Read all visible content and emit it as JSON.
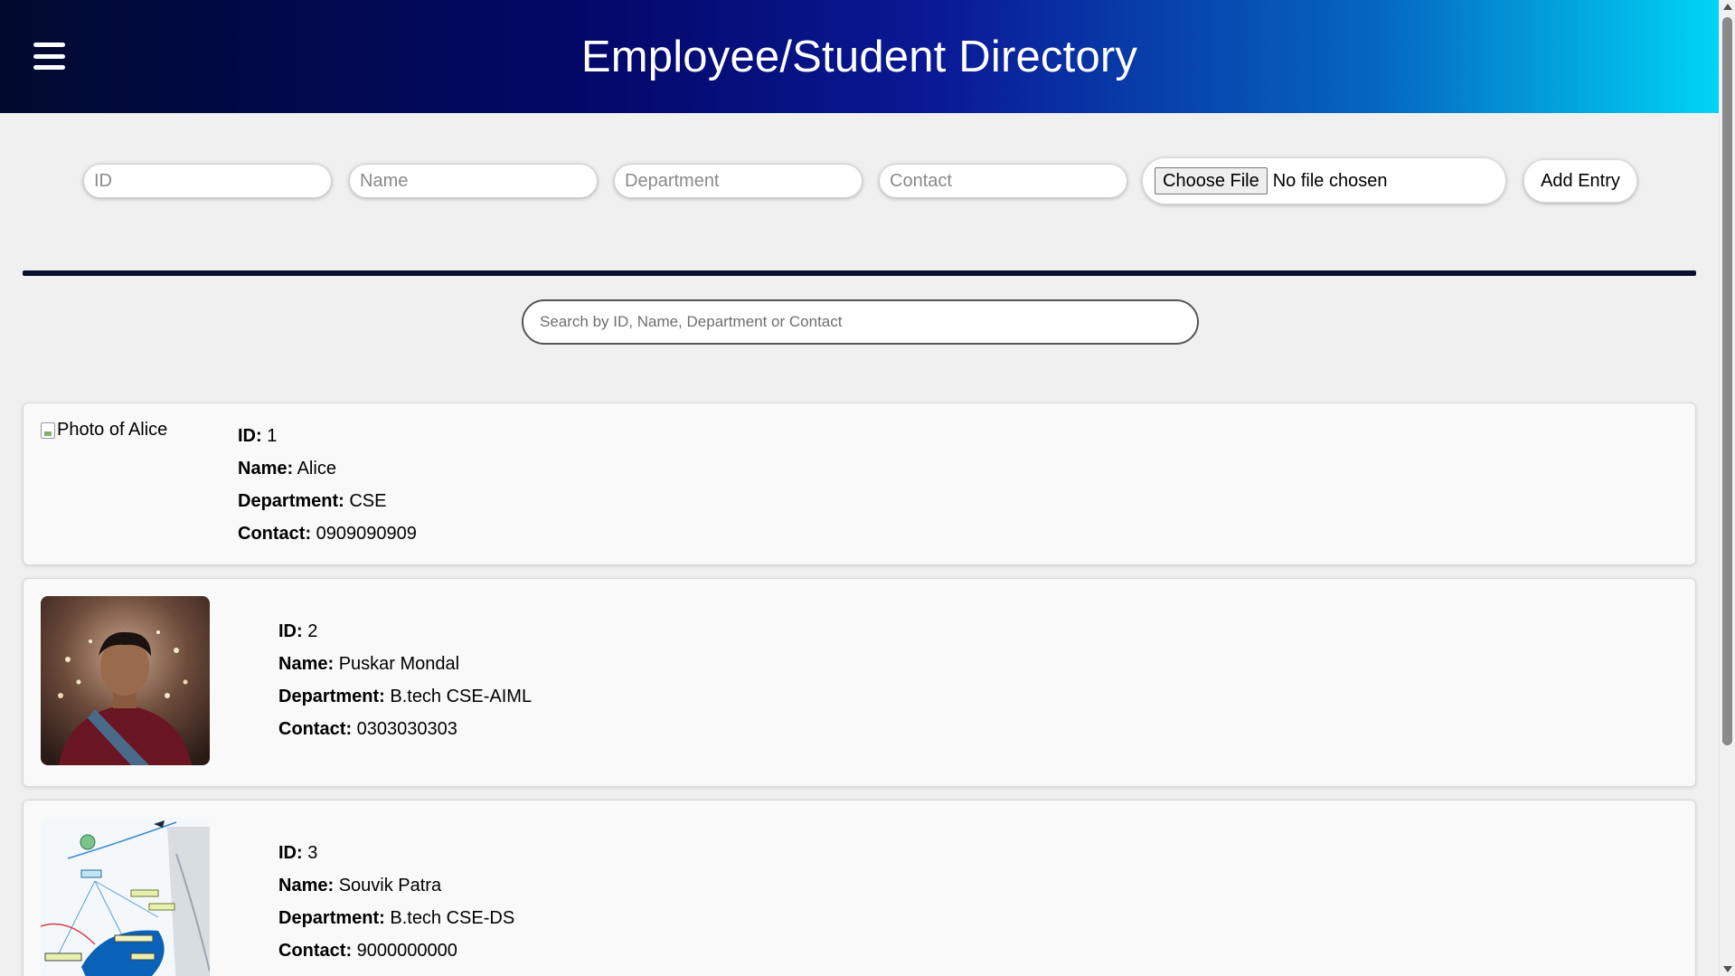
{
  "header": {
    "title": "Employee/Student Directory",
    "menu_icon": "hamburger-menu-icon"
  },
  "form": {
    "id_placeholder": "ID",
    "name_placeholder": "Name",
    "department_placeholder": "Department",
    "contact_placeholder": "Contact",
    "choose_file_label": "Choose File",
    "file_status": "No file chosen",
    "add_button_label": "Add Entry"
  },
  "search": {
    "placeholder": "Search by ID, Name, Department or Contact"
  },
  "labels": {
    "id": "ID:",
    "name": "Name:",
    "department": "Department:",
    "contact": "Contact:"
  },
  "entries": [
    {
      "id": "1",
      "name": "Alice",
      "department": "CSE",
      "contact": "0909090909",
      "photo_alt": "Photo of Alice",
      "photo_loaded": false
    },
    {
      "id": "2",
      "name": "Puskar Mondal",
      "department": "B.tech CSE-AIML",
      "contact": "0303030303",
      "photo_loaded": true
    },
    {
      "id": "3",
      "name": "Souvik Patra",
      "department": "B.tech CSE-DS",
      "contact": "9000000000",
      "photo_loaded": true
    }
  ],
  "colors": {
    "header_start": "#000a2e",
    "header_mid": "#03086a",
    "header_end": "#00d4f5",
    "divider": "#0a0f2e"
  }
}
